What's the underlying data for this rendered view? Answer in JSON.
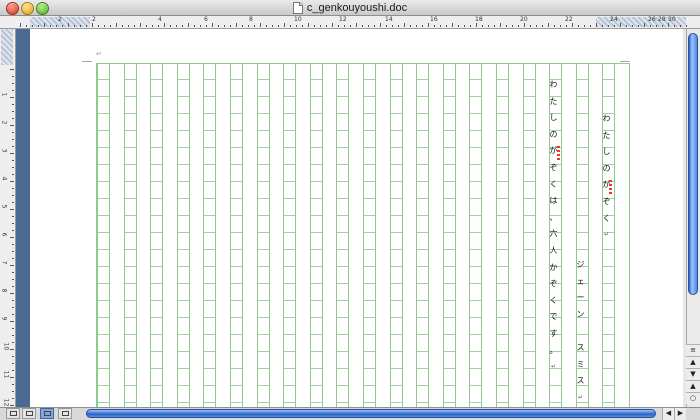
{
  "window": {
    "title": "c_genkouyoushi.doc"
  },
  "ruler": {
    "h_numbers": [
      "2",
      "2",
      "4",
      "6",
      "8",
      "10",
      "12",
      "14",
      "16",
      "18",
      "20",
      "22",
      "24",
      "26",
      "28",
      "30"
    ],
    "v_numbers": [
      "1",
      "2",
      "3",
      "4",
      "5",
      "6",
      "7",
      "8",
      "9",
      "10",
      "11",
      "12"
    ]
  },
  "document": {
    "paragraph_mark": "↵",
    "columns": [
      {
        "name": "col-title",
        "chars": [
          "わ",
          "た",
          "し",
          "の",
          "が",
          "ぞ",
          "く",
          "↵"
        ]
      },
      {
        "name": "col-author",
        "chars": [
          "ジ",
          "ェ",
          "ー",
          "ン",
          "",
          "ス",
          "ミ",
          "ス",
          "↵"
        ]
      },
      {
        "name": "col-body",
        "chars": [
          "わ",
          "た",
          "し",
          "の",
          "が",
          "ぞ",
          "く",
          "は",
          "、",
          "六",
          "人",
          "か",
          "ぞ",
          "く",
          "で",
          "す",
          "。",
          "↵"
        ]
      }
    ]
  },
  "colors": {
    "grid": "#8ccc8c",
    "scroll_accent": "#3d78d8",
    "spelling": "#e33"
  },
  "icons": {
    "close": "close-icon",
    "minimize": "minimize-icon",
    "zoom": "zoom-icon",
    "up": "arrow-up-icon",
    "down": "arrow-down-icon",
    "left": "arrow-left-icon",
    "right": "arrow-right-icon"
  }
}
